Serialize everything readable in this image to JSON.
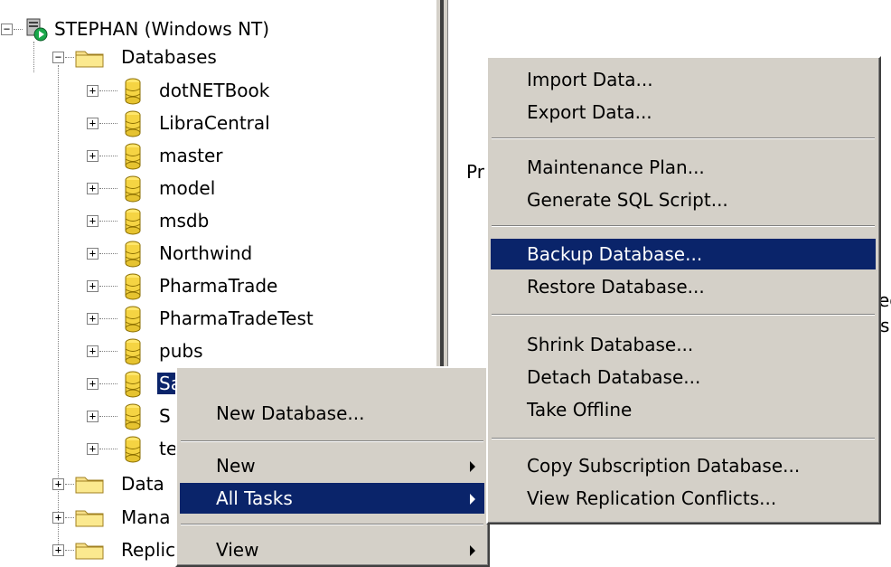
{
  "server": {
    "label": "STEPHAN (Windows NT)"
  },
  "tree": {
    "databases_folder": "Databases",
    "databases": [
      "dotNETBook",
      "LibraCentral",
      "master",
      "model",
      "msdb",
      "Northwind",
      "PharmaTrade",
      "PharmaTradeTest",
      "pubs",
      "Sales",
      "S",
      "te"
    ],
    "other_folders": [
      "Data",
      "Mana",
      "Replic"
    ]
  },
  "right_pane": {
    "fragments": [
      "Pr",
      "ec",
      "s"
    ]
  },
  "context_menu": {
    "items": [
      {
        "label": "New Database...",
        "submenu": false
      },
      {
        "label": "New",
        "submenu": true
      },
      {
        "label": "All Tasks",
        "submenu": true,
        "highlighted": true
      },
      {
        "label": "View",
        "submenu": true
      }
    ]
  },
  "tasks_submenu": {
    "items": [
      "Import Data...",
      "Export Data...",
      "Maintenance Plan...",
      "Generate SQL Script...",
      "Backup Database...",
      "Restore Database...",
      "Shrink Database...",
      "Detach Database...",
      "Take Offline",
      "Copy Subscription Database...",
      "View Replication Conflicts..."
    ],
    "highlighted": "Backup Database..."
  },
  "colors": {
    "menu_bg": "#d4d0c8",
    "selection": "#0a246a"
  }
}
